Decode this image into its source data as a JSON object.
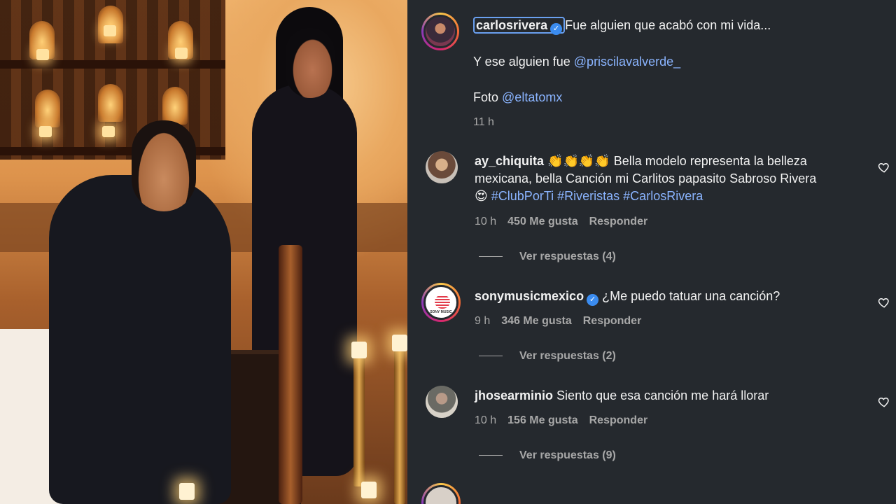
{
  "caption": {
    "username": "carlosrivera",
    "line1": "Fue alguien que acabó con mi vida...",
    "line2_prefix": "Y ese alguien fue ",
    "line2_mention": "@priscilavalverde_",
    "line3_prefix": "Foto ",
    "line3_mention": "@eltatomx",
    "time": "11 h"
  },
  "comments": [
    {
      "username": "ay_chiquita",
      "text_line1": "👏👏👏👏 Bella modelo representa la belleza",
      "text_line2": "mexicana, bella Canción mi Carlitos papasito Sabroso Rivera",
      "text_line3_emoji": "😍",
      "hashtags": "#ClubPorTi #Riveristas #CarlosRivera",
      "time": "10 h",
      "likes": "450 Me gusta",
      "reply": "Responder",
      "view_replies": "Ver respuestas (4)"
    },
    {
      "username": "sonymusicmexico",
      "text_line1": "¿Me puedo tatuar una canción?",
      "time": "9 h",
      "likes": "346 Me gusta",
      "reply": "Responder",
      "view_replies": "Ver respuestas (2)",
      "avatar_text": "SONY MUSIC"
    },
    {
      "username": "jhosearminio",
      "text_line1": "Siento que esa canción me hará llorar",
      "time": "10 h",
      "likes": "156 Me gusta",
      "reply": "Responder",
      "view_replies": "Ver respuestas (9)"
    }
  ],
  "icons": {
    "verified": "verified-badge-icon",
    "like": "heart-outline-icon"
  },
  "colors": {
    "background": "#25292e",
    "link": "#8ab4ff",
    "verified": "#3b8cf0",
    "muted": "#a8a8a8"
  }
}
